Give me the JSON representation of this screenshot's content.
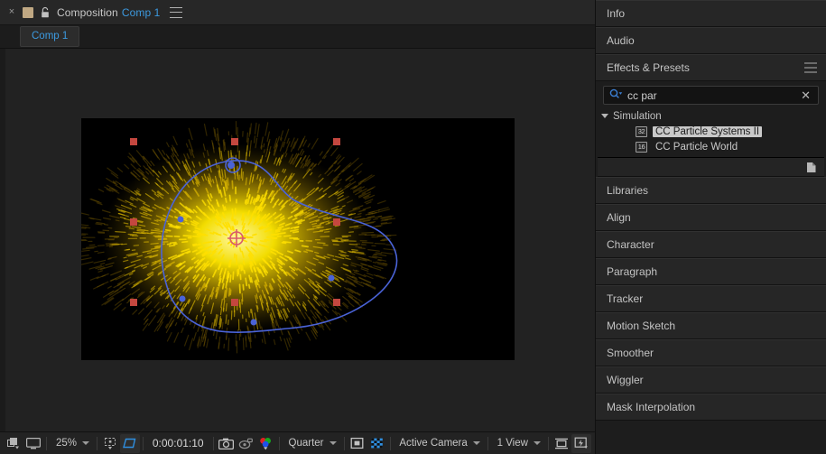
{
  "composition": {
    "close_label": "×",
    "title_prefix": "Composition",
    "title_name": "Comp 1",
    "tab_label": "Comp 1",
    "menu_icon": "hamburger-menu-icon",
    "lock_icon": "lock-icon",
    "color_swatch": "#c0a883"
  },
  "viewer": {
    "background": "#222222",
    "canvas_background": "#000000",
    "particles": {
      "color_bright": "#ffe000",
      "color_mid": "#d8b400",
      "color_dark": "#6b5200",
      "path_color": "#4a63d8",
      "handle_color": "#c4473f",
      "anchor_color": "#d85a6a"
    }
  },
  "viewer_toolbar": {
    "always_preview_icon": "always-preview-icon",
    "monitor_icon": "monitor-icon",
    "zoom_value": "25%",
    "region_of_interest_icon": "region-of-interest-icon",
    "transparency_grid_icon": "comp-boundary-icon",
    "timecode": "0:00:01:10",
    "snapshot_icon": "snapshot-camera-icon",
    "show_snapshot_icon": "show-snapshot-icon",
    "channel_icon": "rgb-channel-icon",
    "resolution_value": "Quarter",
    "mask_visibility_icon": "mask-visibility-icon",
    "toggle_transparency_icon": "toggle-transparency-grid-icon",
    "camera_value": "Active Camera",
    "views_value": "1 View",
    "pixel_aspect_icon": "pixel-aspect-ratio-icon",
    "fast_previews_icon": "fast-previews-icon"
  },
  "side_panels": {
    "info": {
      "title": "Info"
    },
    "audio": {
      "title": "Audio"
    },
    "effects_presets": {
      "title": "Effects & Presets",
      "menu_icon": "panel-menu-icon",
      "search": {
        "value": "cc par",
        "placeholder": "",
        "search_icon": "search-icon",
        "clear_icon": "clear-search-icon"
      },
      "groups": [
        {
          "name": "Simulation",
          "expanded": true,
          "effects": [
            {
              "name": "CC Particle Systems II",
              "bit_depth": "32",
              "selected": true
            },
            {
              "name": "CC Particle World",
              "bit_depth": "16",
              "selected": false
            }
          ]
        }
      ],
      "footer_icon": "new-animation-preset-icon"
    },
    "collapsed": [
      {
        "title": "Libraries"
      },
      {
        "title": "Align"
      },
      {
        "title": "Character"
      },
      {
        "title": "Paragraph"
      },
      {
        "title": "Tracker"
      },
      {
        "title": "Motion Sketch"
      },
      {
        "title": "Smoother"
      },
      {
        "title": "Wiggler"
      },
      {
        "title": "Mask Interpolation"
      }
    ]
  }
}
